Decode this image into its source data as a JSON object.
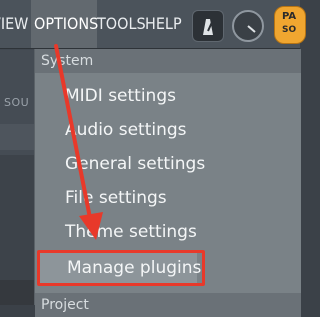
{
  "menubar": {
    "items": [
      {
        "label": "VIEW"
      },
      {
        "label": "OPTIONS"
      },
      {
        "label": "TOOLS"
      },
      {
        "label": "HELP"
      }
    ],
    "orange_button": {
      "line1": "PA",
      "line2": "SO"
    }
  },
  "background": {
    "left_label": "SOU"
  },
  "dropdown": {
    "section_system": "System",
    "items": [
      {
        "label": "MIDI settings"
      },
      {
        "label": "Audio settings"
      },
      {
        "label": "General settings"
      },
      {
        "label": "File settings"
      },
      {
        "label": "Theme settings"
      },
      {
        "label": "Manage plugins"
      }
    ],
    "section_project": "Project"
  },
  "colors": {
    "annotation": "#e8392a",
    "menu_active_bg": "#62696f",
    "dropdown_bg": "#7a8287",
    "accent_orange": "#f0a630"
  }
}
